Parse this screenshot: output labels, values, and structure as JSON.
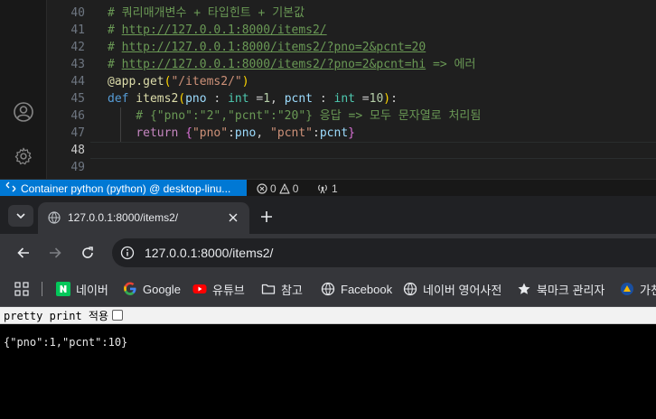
{
  "editor": {
    "line_numbers": [
      "40",
      "41",
      "42",
      "43",
      "44",
      "45",
      "46",
      "47",
      "48",
      "49"
    ],
    "active_line": "48",
    "lines": {
      "l40": "# 쿼리매개변수 + 타입힌트 + 기본값",
      "l41_prefix": "# ",
      "l41_link": "http://127.0.0.1:8000/items2/",
      "l42_prefix": "# ",
      "l42_link": "http://127.0.0.1:8000/items2/?pno=2&pcnt=20",
      "l43_prefix": "# ",
      "l43_link": "http://127.0.0.1:8000/items2/?pno=2&pcnt=hi",
      "l43_suffix": " => 에러",
      "l44_deco": "@app.get",
      "l44_open": "(",
      "l44_str": "\"/items2/\"",
      "l44_close": ")",
      "l45_def": "def",
      "l45_name": " items2",
      "l45_open": "(",
      "l45_p1": "pno",
      "l45_c1": " : ",
      "l45_t1": "int",
      "l45_eq1": " =",
      "l45_v1": "1",
      "l45_comma": ", ",
      "l45_p2": "pcnt",
      "l45_c2": " : ",
      "l45_t2": "int",
      "l45_eq2": " =",
      "l45_v2": "10",
      "l45_close": ")",
      "l45_colon": ":",
      "l46": "    # {\"pno\":\"2\",\"pcnt\":\"20\"} 응답 => 모두 문자열로 처리됨",
      "l47_indent": "    ",
      "l47_ret": "return",
      "l47_sp": " ",
      "l47_open": "{",
      "l47_k1": "\"pno\"",
      "l47_col1": ":",
      "l47_v1": "pno",
      "l47_comma": ", ",
      "l47_k2": "\"pcnt\"",
      "l47_col2": ":",
      "l47_v2": "pcnt",
      "l47_close": "}"
    },
    "activity_icons": [
      "account-icon",
      "gear-icon"
    ]
  },
  "statusbar": {
    "remote_label": "Container python (python) @ desktop-linu...",
    "errors": "0",
    "warnings": "0",
    "ports": "1"
  },
  "browser": {
    "tab_title": "127.0.0.1:8000/items2/",
    "url": "127.0.0.1:8000/items2/",
    "bookmarks": [
      {
        "label": "네이버",
        "icon": "naver-icon"
      },
      {
        "label": "Google",
        "icon": "google-icon"
      },
      {
        "label": "유튜브",
        "icon": "youtube-icon"
      },
      {
        "label": "참고",
        "icon": "folder-icon"
      },
      {
        "label": "Facebook",
        "icon": "globe-icon"
      },
      {
        "label": "네이버 영어사전",
        "icon": "globe-icon"
      },
      {
        "label": "북마크 관리자",
        "icon": "star-icon"
      },
      {
        "label": "가천",
        "icon": "gachon-icon"
      }
    ]
  },
  "page": {
    "pretty_print_label": "pretty print 적용",
    "json_output": "{\"pno\":1,\"pcnt\":10}"
  },
  "colors": {
    "remote_bg": "#0078d4",
    "comment": "#6a9955",
    "keyword": "#569cd6",
    "function": "#dcdcaa",
    "string": "#ce9178",
    "number": "#b5cea8"
  }
}
